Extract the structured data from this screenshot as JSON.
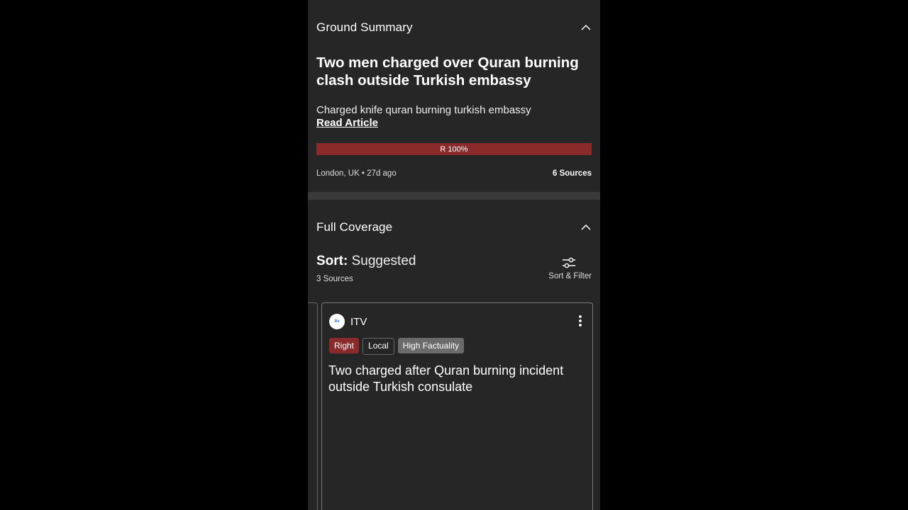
{
  "ground_summary": {
    "title": "Ground Summary",
    "headline": "Two men charged over Quran burning clash outside Turkish embassy",
    "description": "Charged knife quran burning turkish embassy",
    "read_label": "Read Article",
    "bias_label": "R 100%",
    "bias_right_fraction": 1.0,
    "location_time": "London, UK • 27d ago",
    "sources": "6 Sources"
  },
  "full_coverage": {
    "title": "Full Coverage",
    "sort_label": "Sort:",
    "sort_value": "Suggested",
    "sources_count": "3 Sources",
    "filter_label": "Sort & Filter"
  },
  "card": {
    "logo_text": "itv",
    "source": "ITV",
    "tags": [
      "Right",
      "Local",
      "High Factuality"
    ],
    "title": "Two charged after Quran burning incident outside Turkish consulate"
  },
  "colors": {
    "right_bias": "#8b2a2a",
    "background": "#262626",
    "page": "#000000"
  }
}
